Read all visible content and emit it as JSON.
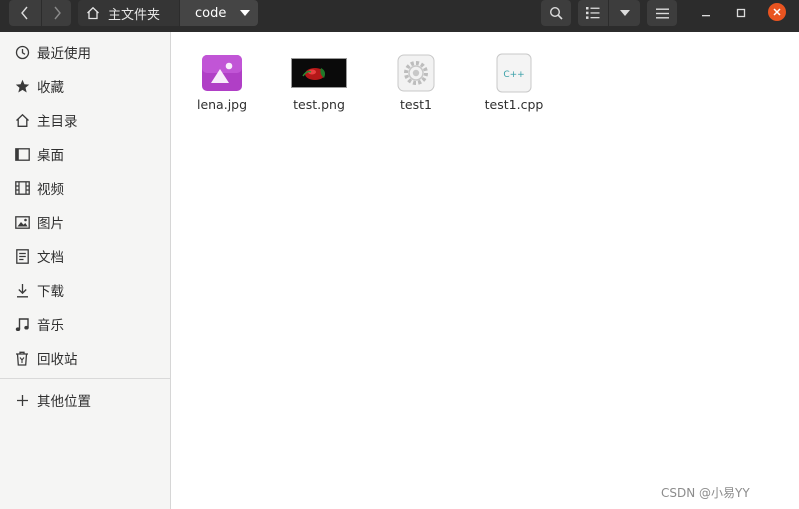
{
  "header": {
    "breadcrumb": {
      "home_label": "主文件夹",
      "current_label": "code"
    }
  },
  "sidebar": {
    "items": [
      {
        "label": "最近使用",
        "icon": "clock-icon"
      },
      {
        "label": "收藏",
        "icon": "star-icon"
      },
      {
        "label": "主目录",
        "icon": "home-icon"
      },
      {
        "label": "桌面",
        "icon": "desktop-icon"
      },
      {
        "label": "视频",
        "icon": "film-icon"
      },
      {
        "label": "图片",
        "icon": "picture-icon"
      },
      {
        "label": "文档",
        "icon": "document-icon"
      },
      {
        "label": "下载",
        "icon": "download-icon"
      },
      {
        "label": "音乐",
        "icon": "music-icon"
      },
      {
        "label": "回收站",
        "icon": "trash-icon"
      }
    ],
    "other_locations": {
      "label": "其他位置",
      "icon": "plus-icon"
    }
  },
  "files": [
    {
      "name": "lena.jpg",
      "icon": "image-file-icon"
    },
    {
      "name": "test.png",
      "icon": "thumbnail-image"
    },
    {
      "name": "test1",
      "icon": "executable-gear-icon"
    },
    {
      "name": "test1.cpp",
      "icon": "cpp-source-icon",
      "icon_text": "C++"
    }
  ],
  "watermark": "CSDN @小易YY",
  "colors": {
    "header_bg": "#2c2c2c",
    "close_button": "#e95420",
    "sidebar_bg": "#f5f5f4",
    "image_icon": "#b03fc6"
  }
}
